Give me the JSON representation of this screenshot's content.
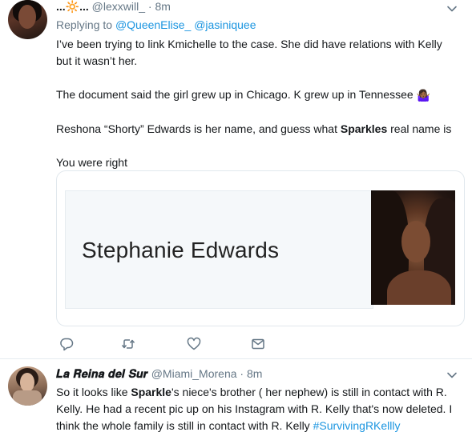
{
  "tweet1": {
    "display_name": "...🔆...",
    "handle": "@lexxwill_",
    "separator": "·",
    "time": "8m",
    "replying_label": "Replying to",
    "replying_mentions": [
      "@QueenElise_",
      "@jasiniquee"
    ],
    "paragraphs": [
      "I’ve been trying to link Kmichelle to the case. She did have relations with Kelly but it wasn’t her.",
      "The document said the girl grew up in Chicago. K grew up in Tennessee",
      "Reshona “Shorty” Edwards is her name, and guess what ",
      "You were right"
    ],
    "p2_emoji": "🤷🏾‍♀️",
    "p3_bold": "Sparkles",
    "p3_tail": " real name is",
    "card": {
      "name": "Stephanie Edwards"
    },
    "icons": [
      "reply-icon",
      "retweet-icon",
      "like-icon",
      "dm-icon"
    ]
  },
  "tweet2": {
    "display_name": "𝑳𝒂 𝑹𝒆𝒊𝒏𝒂 𝒅𝒆𝒍 𝑺𝒖𝒓",
    "handle": "@Miami_Morena",
    "separator": "·",
    "time": "8m",
    "text_pre": "So it looks like ",
    "text_bold": "Sparkle",
    "text_post": "'s niece's brother ( her nephew) is still in contact with R. Kelly. He had a recent pic up on his Instagram with R. Kelly that's now deleted. I think the whole family is still in contact with R. Kelly ",
    "hashtag": "#SurvivingRKellly"
  },
  "colors": {
    "link": "#1b95e0",
    "secondary_text": "#657786",
    "divider": "#e6ecf0"
  }
}
